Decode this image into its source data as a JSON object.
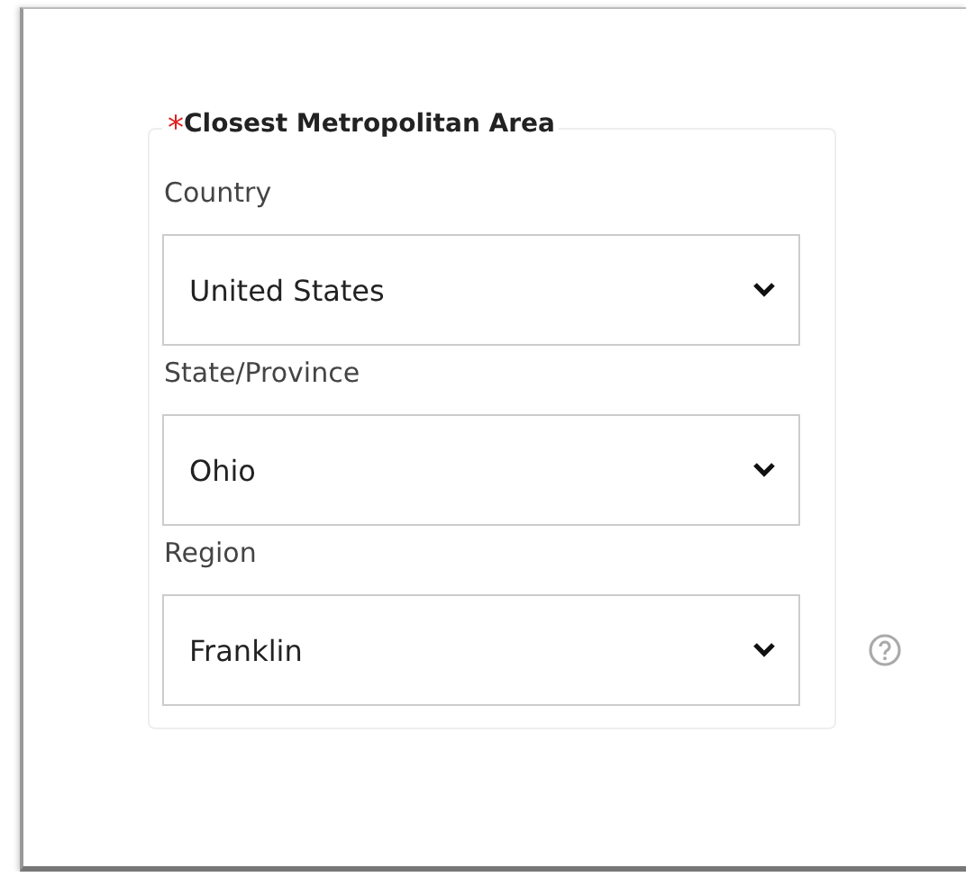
{
  "group": {
    "title": "Closest Metropolitan Area",
    "required": true,
    "required_mark": "*"
  },
  "fields": [
    {
      "label": "Country",
      "value": "United States",
      "help": false
    },
    {
      "label": "State/Province",
      "value": "Ohio",
      "help": false
    },
    {
      "label": "Region",
      "value": "Franklin",
      "help": true
    }
  ]
}
